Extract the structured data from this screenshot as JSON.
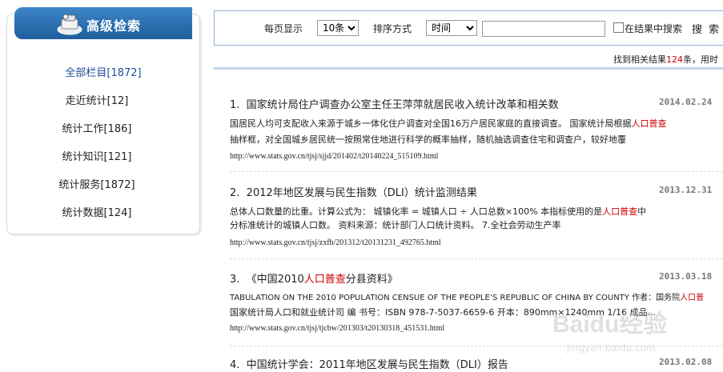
{
  "sidebar": {
    "title": "高级检索",
    "items": [
      {
        "label": "全部栏目[1872]"
      },
      {
        "label": "走近统计[12]"
      },
      {
        "label": "统计工作[186]"
      },
      {
        "label": "统计知识[121]"
      },
      {
        "label": "统计服务[1872]"
      },
      {
        "label": "统计数据[124]"
      }
    ]
  },
  "search": {
    "per_page_label": "每页显示",
    "per_page_value": "10条",
    "sort_label": "排序方式",
    "sort_value": "时间",
    "keyword_value": "",
    "within_label": "在结果中搜索",
    "search_button": "搜 索"
  },
  "summary": {
    "prefix": "找到相关结果",
    "count": "124",
    "suffix": "条，用时"
  },
  "results": [
    {
      "number": "1.",
      "title": "国家统计局住户调查办公室主任王萍萍就居民收入统计改革和相关数",
      "date": "2014.02.24",
      "snippet1_a": "国居民人均可支配收入来源于城乡一体化住户调查对全国16万户居民家庭的直接调查。        国家统计局根据",
      "snippet1_hl": "人口普查",
      "snippet2": "抽样框，对全国城乡居民统一按照常住地进行科学的概率抽样，随机抽选调查住宅和调查户，较好地覆",
      "url": "http://www.stats.gov.cn/tjsj/sjjd/201402/t20140224_515109.html"
    },
    {
      "number": "2.",
      "title": "2012年地区发展与民生指数（DLI）统计监测结果",
      "date": "2013.12.31",
      "snippet1_a": "总体人口数量的比重。计算公式为：      城镇化率 = 城镇人口 ÷ 人口总数×100%      本指标使用的是",
      "snippet1_hl": "人口普查",
      "snippet1_b": "中",
      "snippet2": "分标准统计的城镇人口数。      资料来源：统计部门人口统计资料。      7.全社会劳动生产率",
      "url": "http://www.stats.gov.cn/tjsj/zxfb/201312/t20131231_492765.html"
    },
    {
      "number": "3.",
      "title_a": "《中国2010",
      "title_hl": "人口普查",
      "title_b": "分县资料》",
      "date": "2013.03.18",
      "snippet1_a": "TABULATION ON THE 2010 POPULATION CENSUE OF THE PEOPLE’S REPUBLIC OF CHINA BY COUNTY 作者：国务院",
      "snippet1_hl": "人口普",
      "snippet2": "国家统计局人口和就业统计司 编 书号：ISBN 978-7-5037-6659-6 开本：890mm×1240mm 1/16 成品...",
      "url": "http://www.stats.gov.cn/tjsj/tjcbw/201303/t20130318_451531.html"
    },
    {
      "number": "4.",
      "title": "中国统计学会：2011年地区发展与民生指数（DLI）报告",
      "date": "2013.02.08"
    }
  ],
  "watermark": {
    "brand": "Baidu经验",
    "url": "jingyan.baidu.com"
  },
  "colors": {
    "header_blue": "#2a6fb0",
    "highlight_red": "#cc0000",
    "border_blue": "#8faad4"
  }
}
